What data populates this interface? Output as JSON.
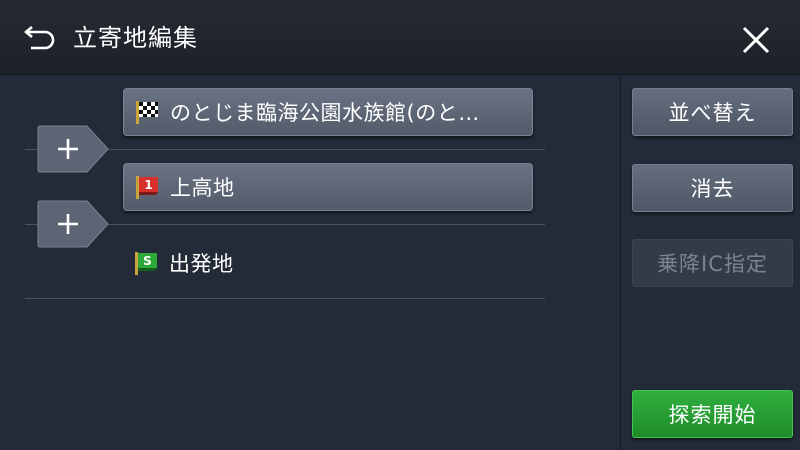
{
  "header": {
    "title": "立寄地編集",
    "back_icon": "back-arrow-icon",
    "close_icon": "close-icon"
  },
  "route": {
    "waypoints": [
      {
        "label": "のとじま臨海公園水族館(のと…",
        "flag": "checkered-flag-icon",
        "kind": "destination"
      },
      {
        "label": "上高地",
        "flag": "red-flag-1-icon",
        "badge": "1",
        "kind": "waypoint"
      },
      {
        "label": "出発地",
        "flag": "green-flag-s-icon",
        "badge": "S",
        "kind": "origin"
      }
    ],
    "add_label": "+"
  },
  "actions": {
    "sort_label": "並べ替え",
    "delete_label": "消去",
    "ic_label": "乗降IC指定",
    "start_label": "探索開始"
  },
  "colors": {
    "background": "#242b38",
    "header": "#1f232b",
    "button": "#5d6575",
    "primary": "#28a035",
    "flag_red": "#d8302a",
    "flag_green": "#2fa83a"
  }
}
